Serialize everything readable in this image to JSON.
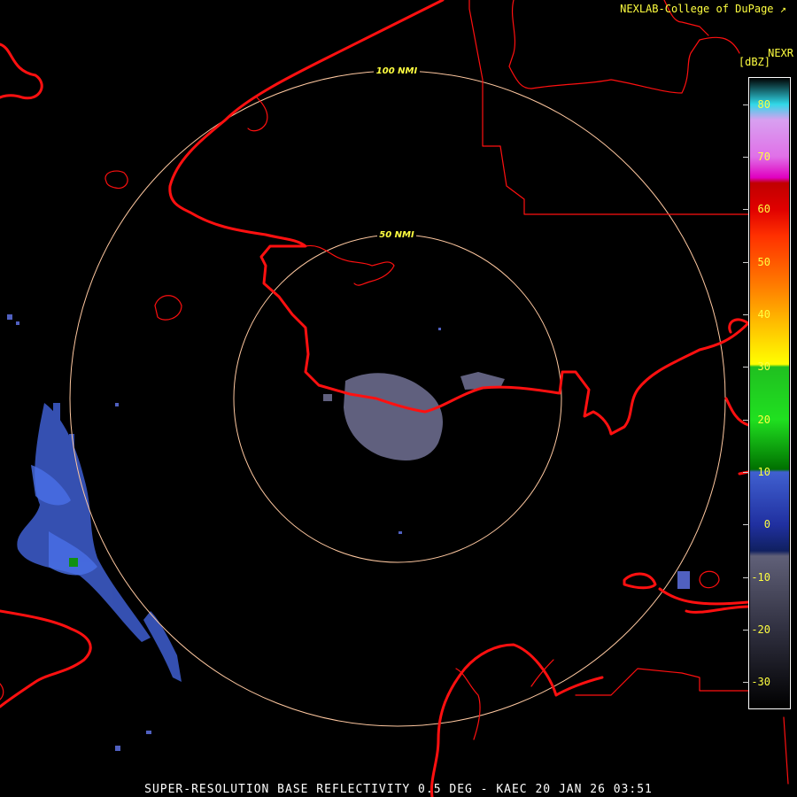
{
  "header": {
    "credit": "NEXLAB-College of DuPage",
    "credit_icon": "external-link-icon",
    "product": "NEXR",
    "units": "[dBZ]"
  },
  "footer": {
    "caption": "SUPER-RESOLUTION BASE REFLECTIVITY 0.5 DEG - KAEC 20 JAN 26 03:51"
  },
  "range_rings": [
    {
      "label": "100 NMI",
      "nmi": 100
    },
    {
      "label": "50 NMI",
      "nmi": 50
    }
  ],
  "colors": {
    "background": "#000000",
    "boundaries": "#ff1010",
    "range_ring": "#ffc8a0",
    "ring_label": "#ffff40",
    "scale_text": "#ffff40",
    "echo_weak": "#3f5fd0",
    "echo_clutter": "#8080a8",
    "echo_green": "#109010"
  },
  "color_scale": {
    "min_dbz": -35,
    "max_dbz": 85,
    "ticks": [
      "80",
      "70",
      "60",
      "50",
      "40",
      "30",
      "20",
      "10",
      "0",
      "-10",
      "-20",
      "-30"
    ],
    "stops": [
      {
        "dbz": 85,
        "color": "#000000"
      },
      {
        "dbz": 80,
        "color": "#30d8e8"
      },
      {
        "dbz": 77,
        "color": "#d8a0f0"
      },
      {
        "dbz": 70,
        "color": "#e070e8"
      },
      {
        "dbz": 66,
        "color": "#e000c0"
      },
      {
        "dbz": 65,
        "color": "#c00000"
      },
      {
        "dbz": 60,
        "color": "#e00000"
      },
      {
        "dbz": 55,
        "color": "#ff3000"
      },
      {
        "dbz": 45,
        "color": "#ff8000"
      },
      {
        "dbz": 38,
        "color": "#ffc000"
      },
      {
        "dbz": 30.5,
        "color": "#ffff00"
      },
      {
        "dbz": 30,
        "color": "#20c020"
      },
      {
        "dbz": 20,
        "color": "#20e020"
      },
      {
        "dbz": 10.5,
        "color": "#007000"
      },
      {
        "dbz": 10,
        "color": "#4060d0"
      },
      {
        "dbz": 0,
        "color": "#2030a0"
      },
      {
        "dbz": -5,
        "color": "#102060"
      },
      {
        "dbz": -6,
        "color": "#606078"
      },
      {
        "dbz": -20,
        "color": "#303040"
      },
      {
        "dbz": -35,
        "color": "#000000"
      }
    ]
  }
}
